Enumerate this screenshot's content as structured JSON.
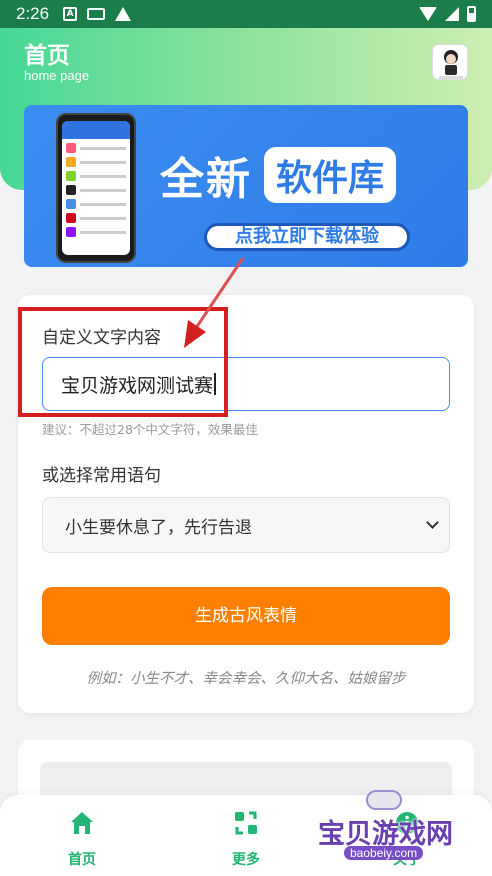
{
  "status_bar": {
    "time": "2:26"
  },
  "header": {
    "title": "首页",
    "subtitle": "home page"
  },
  "banner": {
    "title_main": "全新",
    "title_pill": "软件库",
    "cta": "点我立即下载体验"
  },
  "form": {
    "custom_label": "自定义文字内容",
    "custom_value": "宝贝游戏网测试赛",
    "hint": "建议：不超过28个中文字符，效果最佳",
    "select_label": "或选择常用语句",
    "select_value": "小生要休息了，先行告退",
    "generate_button": "生成古风表情",
    "example": "例如：小生不才、幸会幸会、久仰大名、姑娘留步"
  },
  "bottom_nav": {
    "items": [
      {
        "label": "首页",
        "icon": "home-icon"
      },
      {
        "label": "更多",
        "icon": "refresh-swap-icon"
      },
      {
        "label": "关于",
        "icon": "info-icon"
      }
    ]
  },
  "watermark": {
    "text": "宝贝游戏网",
    "url": "baobeiy.com"
  },
  "colors": {
    "accent_green": "#22b573",
    "button_orange": "#ff8000",
    "annotation_red": "#d51f1f",
    "input_focus_blue": "#4a8af4"
  }
}
